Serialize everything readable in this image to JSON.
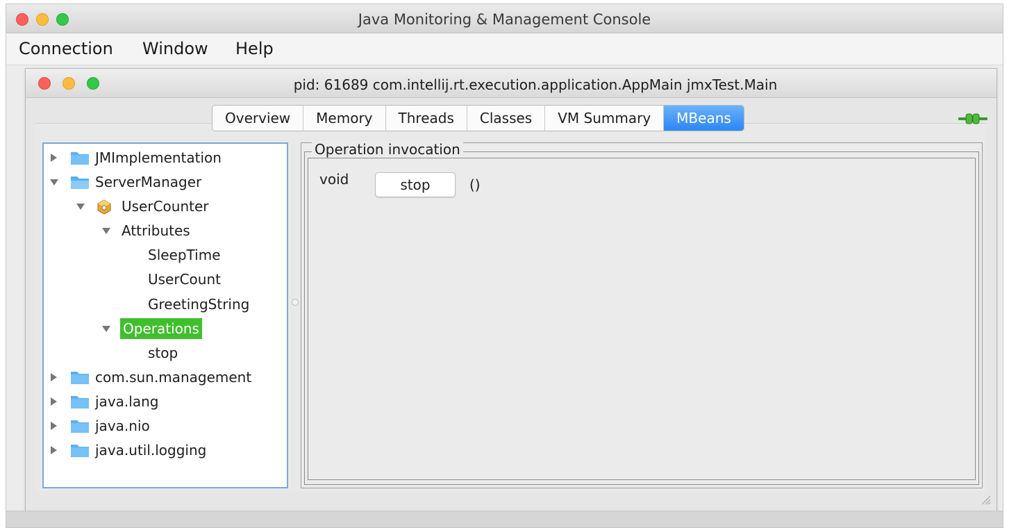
{
  "app": {
    "title": "Java Monitoring & Management Console"
  },
  "menu": {
    "items": [
      "Connection",
      "Window",
      "Help"
    ]
  },
  "inner": {
    "title": "pid: 61689 com.intellij.rt.execution.application.AppMain jmxTest.Main"
  },
  "tabs": {
    "items": [
      "Overview",
      "Memory",
      "Threads",
      "Classes",
      "VM Summary",
      "MBeans"
    ],
    "active": "MBeans"
  },
  "tree": {
    "items": [
      {
        "label": "JMImplementation",
        "expanded": false
      },
      {
        "label": "ServerManager",
        "expanded": true
      },
      {
        "label": "UserCounter",
        "expanded": true
      },
      {
        "label": "Attributes",
        "expanded": true
      },
      {
        "label": "SleepTime"
      },
      {
        "label": "UserCount"
      },
      {
        "label": "GreetingString"
      },
      {
        "label": "Operations",
        "expanded": true,
        "selected": true
      },
      {
        "label": "stop"
      },
      {
        "label": "com.sun.management",
        "expanded": false
      },
      {
        "label": "java.lang",
        "expanded": false
      },
      {
        "label": "java.nio",
        "expanded": false
      },
      {
        "label": "java.util.logging",
        "expanded": false
      }
    ]
  },
  "operation": {
    "group_title": "Operation invocation",
    "return_type": "void",
    "button_label": "stop",
    "params": "()"
  },
  "colors": {
    "active_tab": "#2c86f2",
    "selection": "#3fbf2c",
    "folder": "#5ab0ee",
    "tree_border": "#7aa9d6"
  }
}
